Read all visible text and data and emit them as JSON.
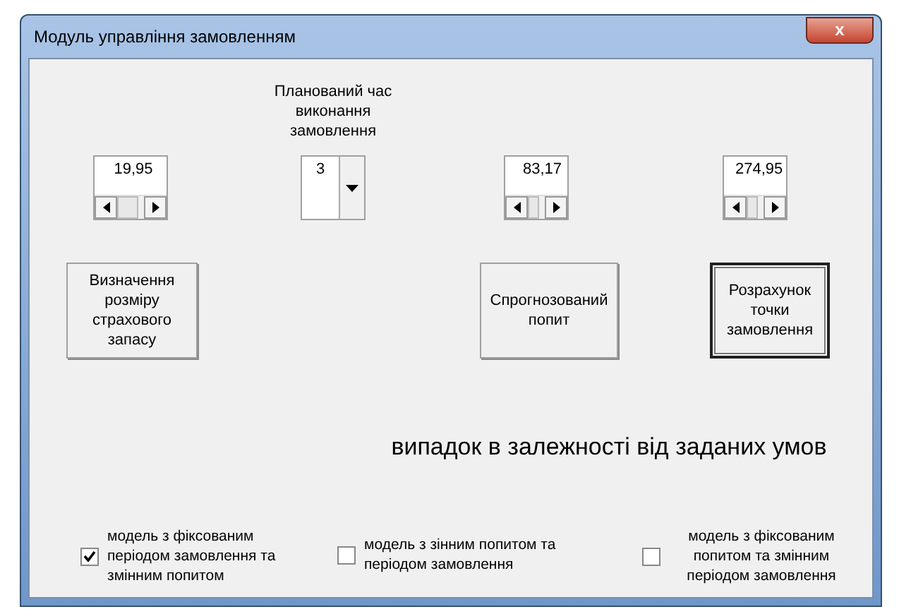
{
  "window": {
    "title": "Модуль управління замовленням",
    "close": "x"
  },
  "inputs": [
    {
      "kind": "spin",
      "value": "19,95"
    },
    {
      "kind": "combo",
      "label": "Планований час виконання замовлення",
      "value": "3"
    },
    {
      "kind": "spin",
      "value": "83,17"
    },
    {
      "kind": "spin",
      "value": "274,95"
    }
  ],
  "buttons": [
    {
      "label": "Визначення розміру страхового запасу",
      "default": false
    },
    {
      "label": "Спрогнозований попит",
      "default": false
    },
    {
      "label": "Розрахунок точки замовлення",
      "default": true
    }
  ],
  "heading": "випадок в залежності від заданих умов",
  "options": [
    {
      "label": "модель з фіксованим періодом замовлення та змінним попитом",
      "checked": true
    },
    {
      "label": "модель з зінним попитом та періодом замовлення",
      "checked": false
    },
    {
      "label": "модель з фіксованим попитом та змінним періодом замовлення",
      "checked": false
    }
  ]
}
